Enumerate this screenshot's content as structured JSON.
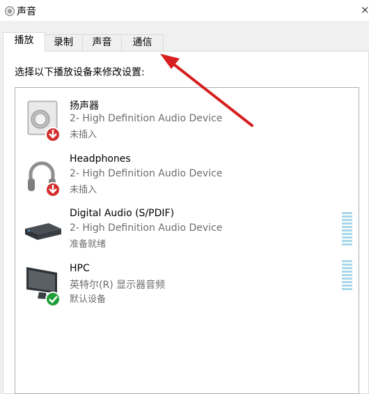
{
  "window": {
    "title": "声音",
    "close_glyph": "×"
  },
  "tabs": [
    {
      "label": "播放",
      "active": true
    },
    {
      "label": "录制",
      "active": false
    },
    {
      "label": "声音",
      "active": false
    },
    {
      "label": "通信",
      "active": false
    }
  ],
  "instruction": "选择以下播放设备来修改设置:",
  "devices": [
    {
      "name": "扬声器",
      "description": "2- High Definition Audio Device",
      "status": "未插入",
      "icon": "speaker-icon",
      "badge": "unplugged-icon"
    },
    {
      "name": "Headphones",
      "description": "2- High Definition Audio Device",
      "status": "未插入",
      "icon": "headphones-icon",
      "badge": "unplugged-icon"
    },
    {
      "name": "Digital Audio (S/PDIF)",
      "description": "2- High Definition Audio Device",
      "status": "准备就绪",
      "icon": "spdif-device-icon",
      "meter": true
    },
    {
      "name": "HPC",
      "description": "英特尔(R) 显示器音频",
      "status": "默认设备",
      "icon": "monitor-icon",
      "badge": "default-check-icon",
      "meter": true
    }
  ],
  "colors": {
    "arrow": "#d61f1f",
    "meter": "#a8d8ea",
    "badge_red": "#d32f2f",
    "badge_green": "#1f9e3a"
  }
}
